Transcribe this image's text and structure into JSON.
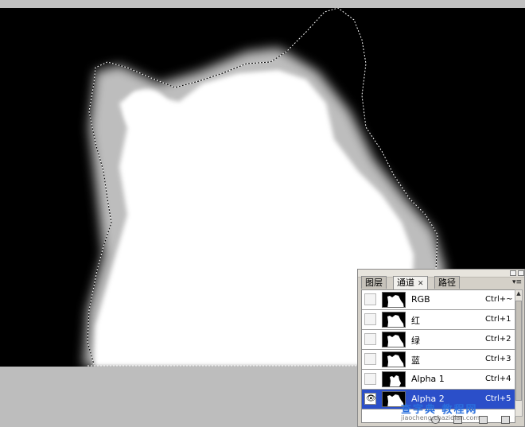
{
  "panel": {
    "tabs": [
      {
        "label": "图层"
      },
      {
        "label": "通道",
        "close": "✕"
      },
      {
        "label": "路径"
      }
    ],
    "menu_glyph": "▾≡",
    "channels": [
      {
        "name": "RGB",
        "shortcut": "Ctrl+~",
        "visible": false
      },
      {
        "name": "红",
        "shortcut": "Ctrl+1",
        "visible": false
      },
      {
        "name": "绿",
        "shortcut": "Ctrl+2",
        "visible": false
      },
      {
        "name": "蓝",
        "shortcut": "Ctrl+3",
        "visible": false
      },
      {
        "name": "Alpha 1",
        "shortcut": "Ctrl+4",
        "visible": false
      },
      {
        "name": "Alpha 2",
        "shortcut": "Ctrl+5",
        "visible": true,
        "selected": true
      }
    ],
    "eye_glyph": "👁",
    "bottom_icons": [
      "load-selection-icon",
      "save-selection-icon",
      "new-channel-icon",
      "delete-channel-icon"
    ]
  },
  "watermark": {
    "line1": "查字典 教程网",
    "line2": "jiaocheng.chazidian.com"
  },
  "colors": {
    "canvas": "#000000",
    "selection": "#2b4fc9",
    "workspace": "#c0c0c0"
  }
}
